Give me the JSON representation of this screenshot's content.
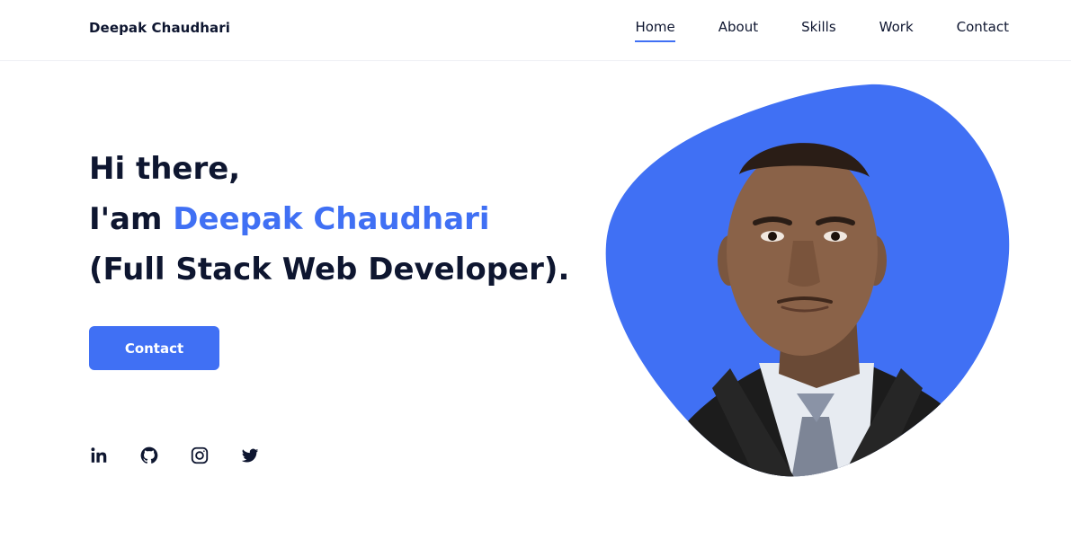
{
  "header": {
    "logo": "Deepak Chaudhari",
    "nav": [
      {
        "label": "Home",
        "active": true
      },
      {
        "label": "About",
        "active": false
      },
      {
        "label": "Skills",
        "active": false
      },
      {
        "label": "Work",
        "active": false
      },
      {
        "label": "Contact",
        "active": false
      }
    ]
  },
  "hero": {
    "greeting": "Hi there,",
    "intro_prefix": "I'am ",
    "name": "Deepak Chaudhari",
    "role": "(Full Stack Web Developer).",
    "button_label": "Contact"
  },
  "socials": [
    {
      "icon": "linkedin-icon"
    },
    {
      "icon": "github-icon"
    },
    {
      "icon": "instagram-icon"
    },
    {
      "icon": "twitter-icon"
    }
  ],
  "colors": {
    "accent": "#4070f4",
    "text": "#0e1630",
    "background": "#ffffff"
  }
}
